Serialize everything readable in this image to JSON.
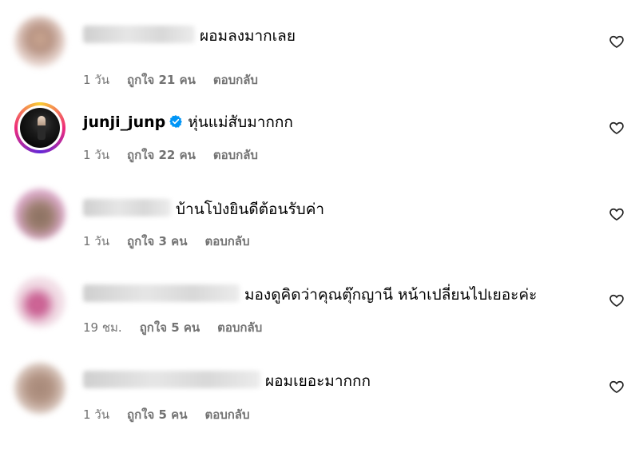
{
  "comments": [
    {
      "username": "",
      "text": "ผอมลงมากเลย",
      "time": "1 วัน",
      "likes": "ถูกใจ 21 คน",
      "reply": "ตอบกลับ",
      "avatar_colors": [
        "#c9a58f",
        "#e8d6d0"
      ]
    },
    {
      "username": "junji_junp",
      "verified": true,
      "text": "หุ่นแม่สับมากกก",
      "time": "1 วัน",
      "likes": "ถูกใจ 22 คน",
      "reply": "ตอบกลับ"
    },
    {
      "username": "",
      "text": "บ้านโป่งยินดีต้อนรับค่า",
      "time": "1 วัน",
      "likes": "ถูกใจ 3 คน",
      "reply": "ตอบกลับ",
      "avatar_colors": [
        "#8a7060",
        "#e7b7d6"
      ]
    },
    {
      "username": "",
      "text": "มองดูคิดว่าคุณตุ๊กญานี หน้าเปลี่ยนไปเยอะค่ะ",
      "time": "19 ชม.",
      "likes": "ถูกใจ 5 คน",
      "reply": "ตอบกลับ",
      "avatar_colors": [
        "#d26a9a",
        "#f3e3ea"
      ]
    },
    {
      "username": "",
      "text": "ผอมเยอะมากกก",
      "time": "1 วัน",
      "likes": "ถูกใจ 5 คน",
      "reply": "ตอบกลับ",
      "avatar_colors": [
        "#a68878",
        "#d8c6bd"
      ]
    }
  ],
  "accent": {
    "verified": "#0095f6",
    "meta_text": "#737373"
  },
  "icons": {
    "like": "heart-outline-icon",
    "verified": "verified-badge-icon"
  }
}
